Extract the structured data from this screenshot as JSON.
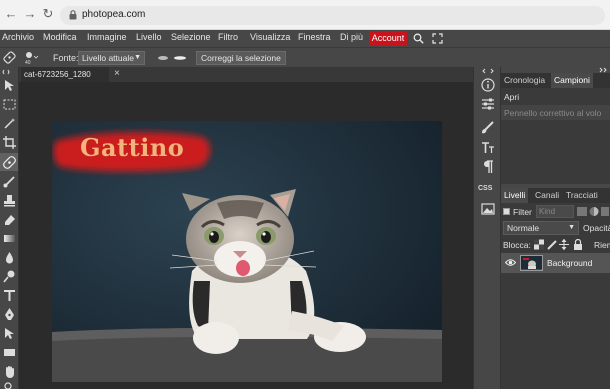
{
  "browser": {
    "url": "photopea.com",
    "back_icon": "arrow-left-icon",
    "forward_icon": "arrow-right-icon",
    "reload_icon": "reload-icon"
  },
  "menu": {
    "items": [
      "Archivio",
      "Modifica",
      "Immagine",
      "Livello",
      "Selezione",
      "Filtro",
      "Visualizza",
      "Finestra",
      "Di più"
    ],
    "account": "Account"
  },
  "options": {
    "source_label": "Fonte:",
    "source_value": "Livello attuale",
    "correct_button": "Correggi la selezione"
  },
  "document": {
    "tab_title": "cat-6723256_1280",
    "overlay_text": "Gattino"
  },
  "history_panel": {
    "tabs": [
      "Cronologia",
      "Campioni"
    ],
    "items": [
      "Apri",
      "Pennello correttivo al volo"
    ]
  },
  "layers_panel": {
    "tabs": [
      "Livelli",
      "Canali",
      "Tracciati"
    ],
    "filter_label": "Filter",
    "filter_kind": "Kind",
    "blend_mode": "Normale",
    "opacity_label": "Opacità",
    "lock_label": "Blocca:",
    "fill_label": "Riem",
    "layer_name": "Background"
  },
  "colors": {
    "accent": "#c8131c",
    "panel_bg": "#474747",
    "workspace_bg": "#2b2b2b"
  }
}
